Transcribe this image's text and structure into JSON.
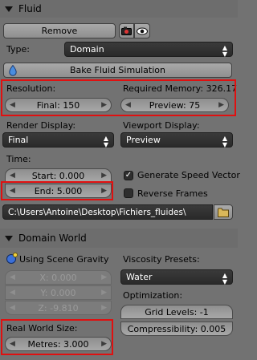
{
  "fluid_panel": {
    "title": "Fluid",
    "remove_label": "Remove",
    "type_label": "Type:",
    "type_value": "Domain",
    "bake_label": "Bake Fluid Simulation",
    "resolution_label": "Resolution:",
    "required_memory_label": "Required Memory: 326.17",
    "final_field": "Final: 150",
    "preview_field": "Preview: 75",
    "render_display_label": "Render Display:",
    "render_display_value": "Final",
    "viewport_display_label": "Viewport Display:",
    "viewport_display_value": "Preview",
    "time_label": "Time:",
    "start_field": "Start: 0.000",
    "end_field": "End: 5.000",
    "generate_speed_vector_label": "Generate Speed Vector",
    "generate_speed_vector_checked": true,
    "reverse_frames_label": "Reverse Frames",
    "reverse_frames_checked": false,
    "cache_path": "C:\\Users\\Antoine\\Desktop\\Fichiers_fluides\\"
  },
  "domain_world_panel": {
    "title": "Domain World",
    "use_scene_gravity_label": "Using Scene Gravity",
    "x_field": "X: 0.000",
    "y_field": "Y: 0.000",
    "z_field": "Z: -9.810",
    "viscosity_presets_label": "Viscosity Presets:",
    "viscosity_presets_value": "Water",
    "optimization_label": "Optimization:",
    "grid_levels_field": "Grid Levels: -1",
    "compressibility_field": "Compressibility: 0.005",
    "real_world_size_label": "Real World Size:",
    "metres_field": "Metres: 3.000"
  },
  "colors": {
    "highlight_box": "#e01010",
    "panel_bg": "#727272",
    "dark_field": "#2e2e2e"
  }
}
